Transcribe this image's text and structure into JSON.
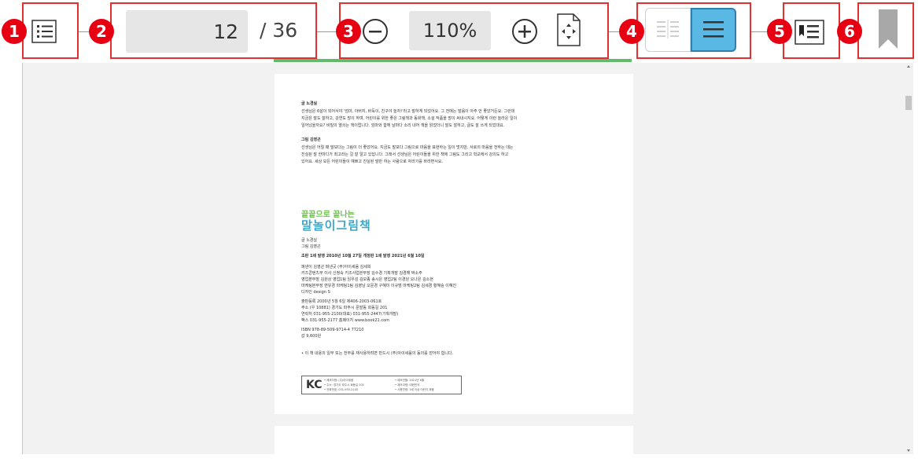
{
  "toolbar": {
    "callouts": [
      "1",
      "2",
      "3",
      "4",
      "5",
      "6"
    ],
    "current_page": "12",
    "total_pages": "/ 36",
    "zoom_level": "110%",
    "icons": [
      "toc-list-icon",
      "zoom-out-icon",
      "zoom-in-icon",
      "fit-page-icon",
      "two-page-view-icon",
      "single-page-view-icon",
      "bookmark-list-icon",
      "bookmark-icon"
    ]
  },
  "document": {
    "para1_title": "글 노경실",
    "para1_lines": [
      "선생님은 6살이 되어서야 '엄마, 아버지, 바둑이, 친구야 놀자!'라고 말하게 되었어요. 그 전에는 발음이 아주 안 좋았거든요. 그런데",
      "지금은 말도 잘하고, 강연도 많이 하며, 어린이를 위한 좋은 그림책과 동화책, 소설 작품을 많이 써내시지요. 어떻게 이런 놀라운 일이",
      "일어났을까요? 비밀의 열쇠는 책이랍니다. 엄마와 함께 날마다 소리 내어 책을 읽었더니 말도 잘하고, 글도 잘 쓰게 되었대요."
    ],
    "para2_title": "그림 김영곤",
    "para2_lines": [
      "선생님은 어릴 때 말보다는 그림이 더 좋았어요. 지금도 말보다 그림으로 마음을 표현하는 일이 멋지만, 서로의 마음을 전하는 데는",
      "진실된 말 한마디가 최고라는 걸 잘 알고 있답니다. 그래서 선생님은 어린이들을 위한 책에 그림도 그리고 학교에서 강의도 하고",
      "있어요. 세상 모든 어린이들이 예쁘고 진실된 말만 하는 사람으로 자라기를 바라면서요."
    ],
    "brand_small": "끝끝으로 끝나는",
    "brand_title": "말놀이그림책",
    "credits_author": "글 노경실",
    "credits_illustrator": "그림 김영곤",
    "edition": "초판 1쇄 발행 2010년 10월 27일   개정판 1쇄 발행 2021년 6월 10일",
    "staff_lines": [
      "펴낸이 김영곤   펴낸곳 (주)아이세움 김세희",
      "키즈콘텐츠부 이사 신정숙   키즈사업본부장 김수경   기획개발 김경해 박소주",
      "영업본부장 김원상   영업1팀 임우성 김모종 송시은   영업2팀 이경원 오나은 김소현",
      "마케팅본부장 변유경   마케팅1팀 김영남 오문경 구혜미 이규범   마케팅2팀 김세경 황혜승 이혜진",
      "디자인 design S"
    ],
    "publisher_lines": [
      "출판등록 2000년 5월 6일 제406-2003-061호",
      "주소 (우 10881) 경기도 파주시 문발동 회동길 201",
      "연락처 031-955-2100(대표) 031-955-2447(기획개발)",
      "팩스 031-955-2177   홈페이지 www.book21.com"
    ],
    "isbn": "ISBN 978-89-509-9714-4 77210",
    "price": "값 9,600원",
    "notice": "• 이 책 내용의 일부 또는 전부를 재사용하려면 반드시 (주)아이세움의 동의를 얻어야 합니다.",
    "cert_mark": "KC",
    "cert_left_lines": [
      "• 제조자명: (주)아이세움",
      "• 주소: 경기도 파주시 회동길 201",
      "• 전화번호: 031-955-2100"
    ],
    "cert_right_lines": [
      "• 제조연월: 2021년 6월",
      "• 제조국명: 대한민국",
      "• 사용연령: 3세 이상 어린이 제품"
    ]
  },
  "colors": {
    "callout": "#e60012",
    "accent": "#62bb6a",
    "selected_view": "#5ab8e4"
  }
}
